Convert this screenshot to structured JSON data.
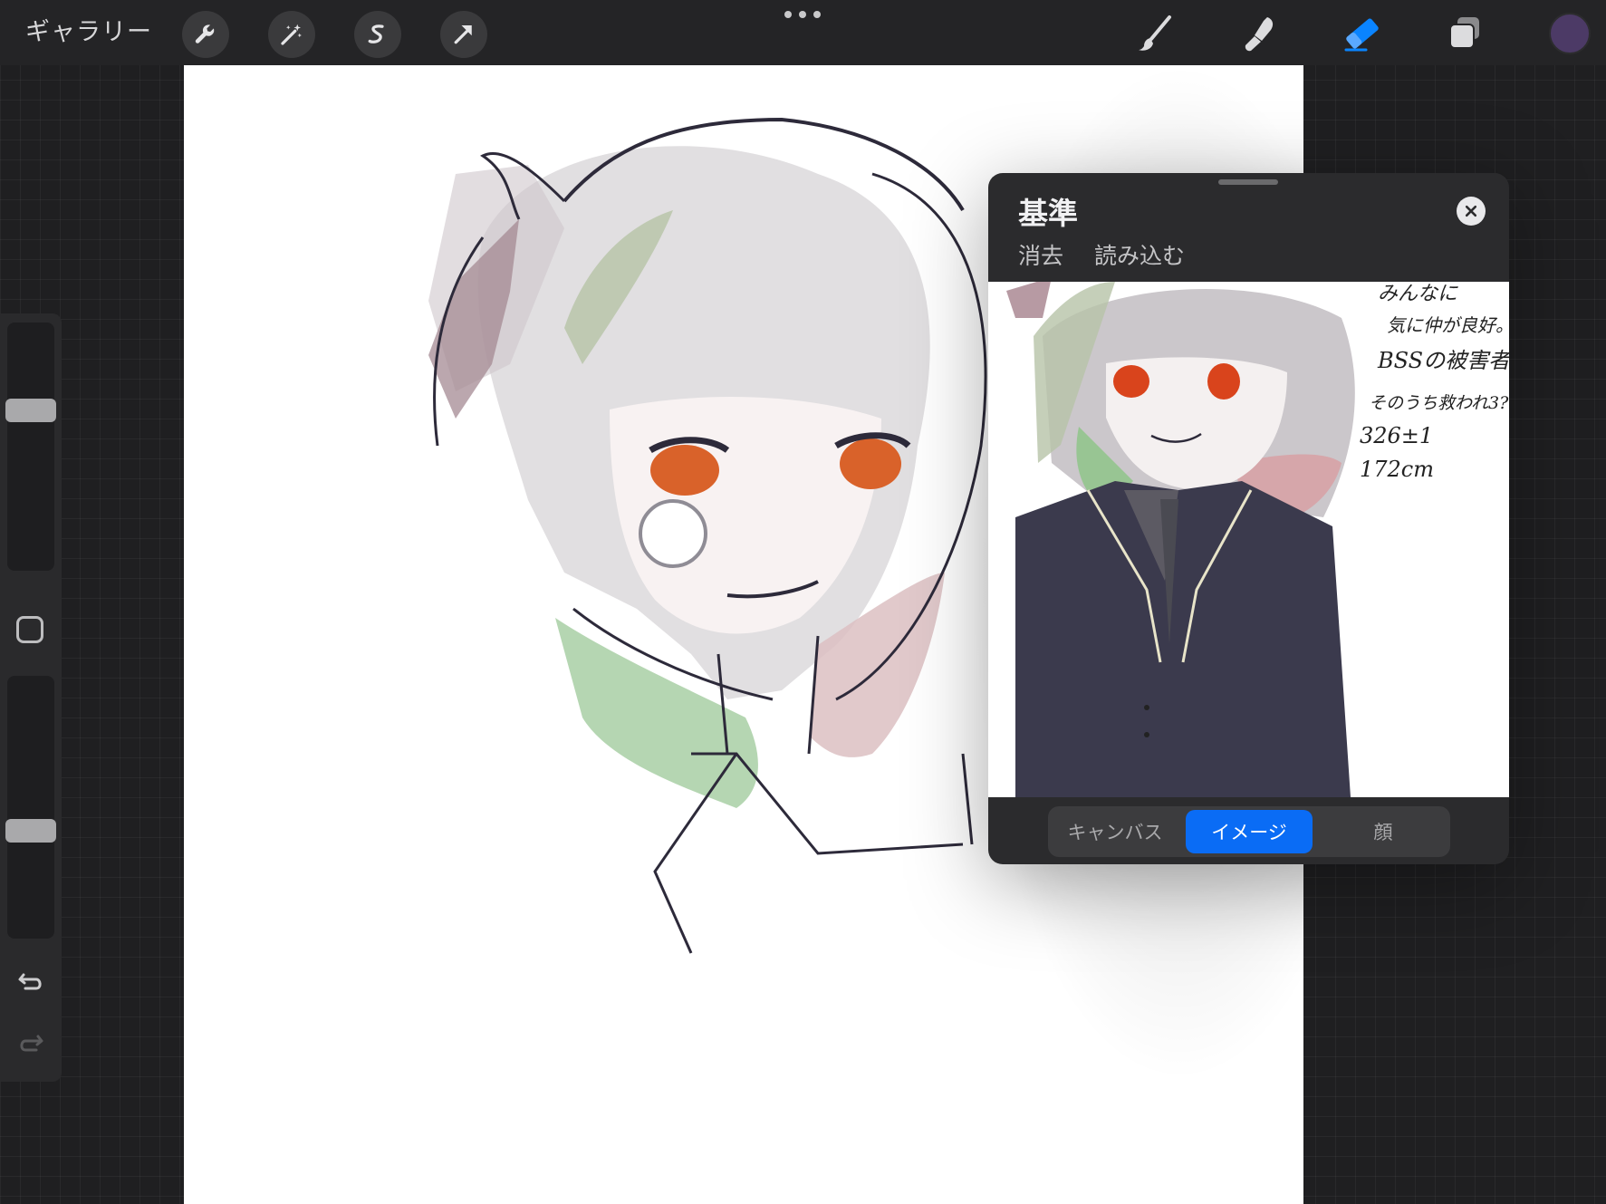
{
  "toolbar": {
    "gallery_label": "ギャラリー",
    "left_tools": [
      "wrench-icon",
      "magic-wand-icon",
      "selection-icon",
      "transform-arrow-icon"
    ],
    "right_tools": [
      "brush-icon",
      "smudge-icon",
      "eraser-icon",
      "layers-icon"
    ],
    "active_tool": "eraser-icon",
    "active_color": "#4c3a66",
    "accent_color": "#0a84ff"
  },
  "reference_panel": {
    "title": "基準",
    "clear_label": "消去",
    "import_label": "読み込む",
    "segments": [
      "キャンバス",
      "イメージ",
      "顔"
    ],
    "selected_segment": "イメージ",
    "image_notes": [
      "みんなに",
      "気に仲が良好。",
      "BSSの被害者。",
      "そのうち救われ3?",
      "326±1",
      "172cm"
    ]
  },
  "sidebar": {
    "size_slider_level": 0.66,
    "opacity_slider_level": 0.4
  }
}
